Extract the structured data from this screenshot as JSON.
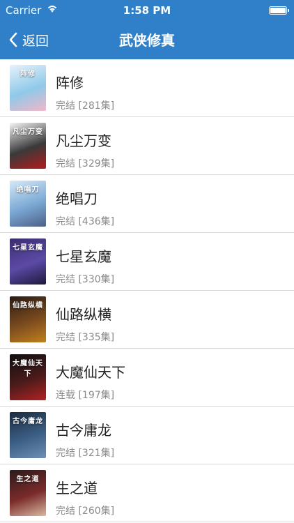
{
  "statusbar": {
    "carrier": "Carrier",
    "time": "1:58 PM"
  },
  "nav": {
    "back_label": "返回",
    "title": "武侠修真"
  },
  "items": [
    {
      "name": "阵修",
      "status": "完结 [281集]",
      "cover_text": "阵修",
      "colors": [
        "#e6f2fb",
        "#8fc9e9",
        "#f2b7c9"
      ]
    },
    {
      "name": "凡尘万变",
      "status": "完结 [329集]",
      "cover_text": "凡尘万变",
      "colors": [
        "#f5f5f5",
        "#3a3a3a",
        "#b31b1b"
      ]
    },
    {
      "name": "绝唱刀",
      "status": "完结 [436集]",
      "cover_text": "绝唱刀",
      "colors": [
        "#d6e9f7",
        "#7aa8d4",
        "#4d5f86"
      ]
    },
    {
      "name": "七星玄魔",
      "status": "完结 [330集]",
      "cover_text": "七星玄魔",
      "colors": [
        "#3b2d6f",
        "#5c4aa5",
        "#1f183d"
      ]
    },
    {
      "name": "仙路纵横",
      "status": "完结 [335集]",
      "cover_text": "仙路纵横",
      "colors": [
        "#2a1a12",
        "#7a4b1f",
        "#c2801c"
      ]
    },
    {
      "name": "大魔仙天下",
      "status": "连载 [197集]",
      "cover_text": "大魔仙天下",
      "colors": [
        "#0f0f0f",
        "#4b1b1b",
        "#b32222"
      ]
    },
    {
      "name": "古今庸龙",
      "status": "完结 [321集]",
      "cover_text": "古今庸龙",
      "colors": [
        "#1b2b40",
        "#3c5f86",
        "#6f8fb3"
      ]
    },
    {
      "name": "生之道",
      "status": "完结 [260集]",
      "cover_text": "生之道",
      "colors": [
        "#2b1b1b",
        "#7b2b2b",
        "#d9b8a2"
      ]
    }
  ]
}
